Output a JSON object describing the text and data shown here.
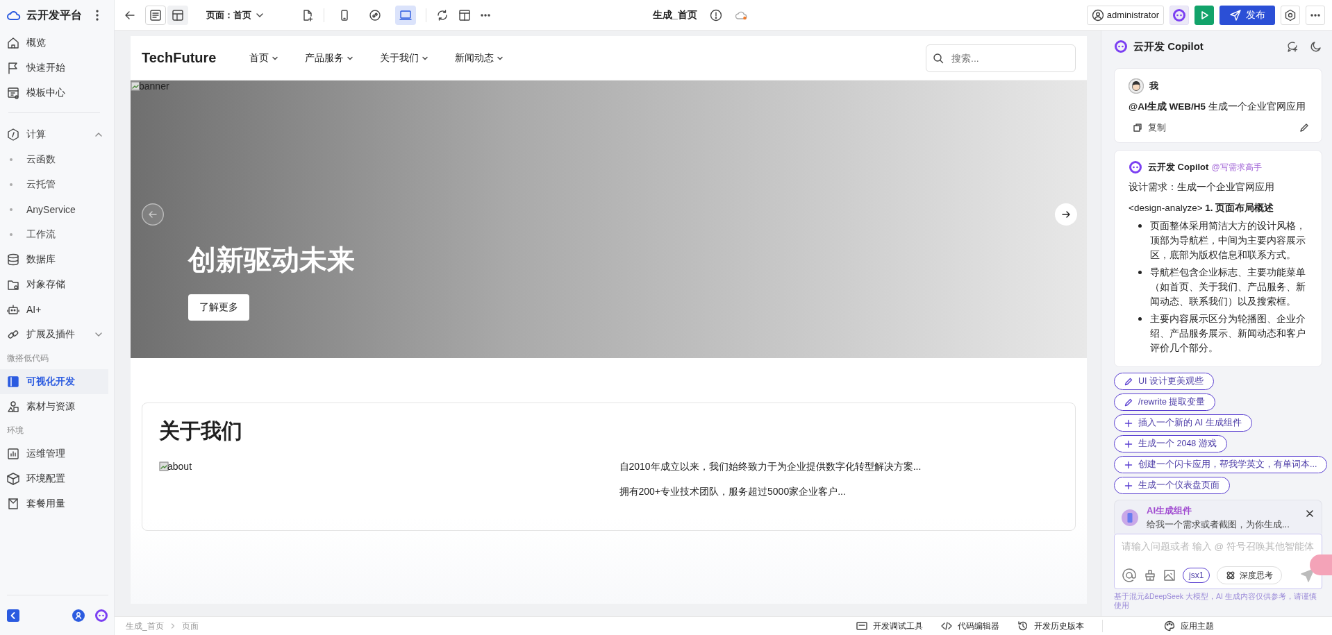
{
  "sidebar": {
    "brand": "云开发平台",
    "sections": [
      {
        "items": [
          {
            "label": "概览",
            "selected": false
          },
          {
            "label": "快速开始",
            "selected": false
          },
          {
            "label": "模板中心",
            "selected": false
          }
        ]
      },
      {
        "items": [
          {
            "label": "计算",
            "selected": false,
            "expanded": true,
            "children": [
              {
                "label": "云函数",
                "selected": false
              },
              {
                "label": "云托管",
                "selected": false
              },
              {
                "label": "AnyService",
                "selected": false
              },
              {
                "label": "工作流",
                "selected": false
              }
            ]
          },
          {
            "label": "数据库",
            "selected": false
          },
          {
            "label": "对象存储",
            "selected": false
          },
          {
            "label": "AI+",
            "selected": false
          },
          {
            "label": "扩展及插件",
            "selected": false,
            "expanded": false
          }
        ]
      },
      {
        "heading": "微搭低代码",
        "items": [
          {
            "label": "可视化开发",
            "selected": true
          },
          {
            "label": "素材与资源",
            "selected": false
          }
        ]
      },
      {
        "heading": "环境",
        "items": [
          {
            "label": "运维管理",
            "selected": false
          },
          {
            "label": "环境配置",
            "selected": false
          },
          {
            "label": "套餐用量",
            "selected": false
          }
        ]
      }
    ]
  },
  "toolbar": {
    "view_modes": [
      {
        "selected": true
      },
      {
        "selected": false
      }
    ],
    "page_select": "页面：首页",
    "devices": [
      {
        "selected": false
      },
      {
        "selected": false
      },
      {
        "selected": true
      }
    ],
    "title": "生成_首页",
    "user": "administrator",
    "publish": "发布"
  },
  "site": {
    "logo": "TechFuture",
    "menu": [
      "首页",
      "产品服务",
      "关于我们",
      "新闻动态"
    ],
    "search_placeholder": "搜索...",
    "banner": {
      "alt": "banner",
      "heading": "创新驱动未来",
      "button": "了解更多"
    },
    "about": {
      "title": "关于我们",
      "image_alt": "about",
      "paragraphs": [
        "自2010年成立以来，我们始终致力于为企业提供数字化转型解决方案...",
        "拥有200+专业技术团队，服务超过5000家企业客户..."
      ]
    }
  },
  "copilot": {
    "title": "云开发 Copilot",
    "messages": [
      {
        "kind": "user",
        "author": "我",
        "text": "**@AI生成 WEB/H5** 生成一个企业官网应用",
        "action": "复制"
      },
      {
        "kind": "bot",
        "author": "云开发 Copilot",
        "tag": "@写需求高手",
        "intro": "设计需求：生成一个企业官网应用",
        "heading": "<design-analyze> **1. 页面布局概述**",
        "bullets": [
          "页面整体采用简洁大方的设计风格，顶部为导航栏，中间为主要内容展示区，底部为版权信息和联系方式。",
          "导航栏包含企业标志、主要功能菜单（如首页、关于我们、产品服务、新闻动态、联系我们）以及搜索框。",
          "主要内容展示区分为轮播图、企业介绍、产品服务展示、新闻动态和客户评价几个部分。"
        ]
      }
    ],
    "suggestions": [
      {
        "kind": "edit",
        "label": "UI 设计更美观些"
      },
      {
        "kind": "edit",
        "label": "/rewrite 提取变量"
      },
      {
        "kind": "add",
        "label": "插入一个新的 AI 生成组件"
      },
      {
        "kind": "add",
        "label": "生成一个 2048 游戏"
      },
      {
        "kind": "add",
        "label": "创建一个闪卡应用，帮我学英文，有单词本..."
      },
      {
        "kind": "add",
        "label": "生成一个仪表盘页面"
      }
    ],
    "component_card": {
      "title": "AI生成组件",
      "description": "给我一个需求或者截图，为你生成..."
    },
    "input": {
      "placeholder": "请输入问题或者 输入 @ 符号召唤其他智能体",
      "tag": "jsx1",
      "deep_think": {
        "label": "深度思考",
        "on": false
      }
    },
    "disclaimer": "基于混元&DeepSeek 大模型，AI 生成内容仅供参考，请谨慎使用"
  },
  "status_bar": {
    "breadcrumb": [
      "生成_首页",
      "页面"
    ],
    "tools": [
      "开发调试工具",
      "代码编辑器",
      "开发历史版本"
    ],
    "theme": "应用主题"
  }
}
